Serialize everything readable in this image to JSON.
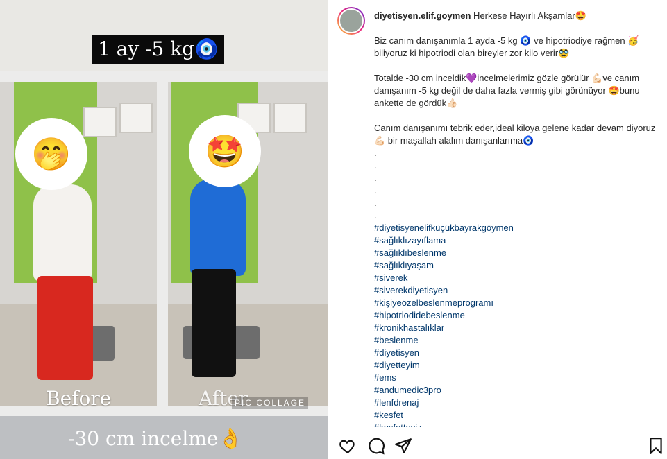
{
  "post_image": {
    "banner_text": "1 ay -5 kg🧿",
    "before_label": "Before",
    "after_label": "After",
    "collage_tag": "PIC COLLAGE",
    "bottom_caption": "-30 cm incelme👌"
  },
  "post": {
    "username": "diyetisyen.elif.goymen",
    "first_line": " Herkese Hayırlı Akşamlar🤩",
    "paragraph1": "Biz canım danışanımla 1 ayda -5 kg 🧿 ve hipotriodiye rağmen 🥳biliyoruz ki hipotriodi olan bireyler zor kilo verir🥸",
    "paragraph2": "Totalde -30 cm inceldik💜incelmelerimiz gözle görülür 💪🏻ve canım danışanım -5 kg değil de daha fazla vermiş gibi görünüyor 🤩bunu ankette de gördük👍🏻",
    "paragraph3": "Canım danışanımı tebrik eder,ideal kiloya gelene kadar devam diyoruz💪🏻 bir maşallah alalım danışanlarıma🧿",
    "dots": [
      ".",
      ".",
      ".",
      ".",
      ".",
      "."
    ],
    "hashtags": [
      "#diyetisyenelifküçükbayrakgöymen",
      "#sağlıklızayıflama",
      "#sağlıklıbeslenme",
      "#sağlıklıyaşam",
      "#siverek",
      "#siverekdiyetisyen",
      "#kişiyeözelbeslenmeprogramı",
      "#hipotriodidebeslenme",
      "#kronikhastalıklar",
      "#beslenme",
      "#diyetisyen",
      "#diyetteyim",
      "#ems",
      "#andumedic3pro",
      "#lenfdrenaj",
      "#kesfet",
      "#kesfetteyiz"
    ]
  },
  "actions": {
    "like_icon": "heart-icon",
    "comment_icon": "comment-icon",
    "share_icon": "share-icon",
    "save_icon": "bookmark-icon"
  },
  "colors": {
    "hashtag": "#00376b",
    "text": "#262626"
  }
}
